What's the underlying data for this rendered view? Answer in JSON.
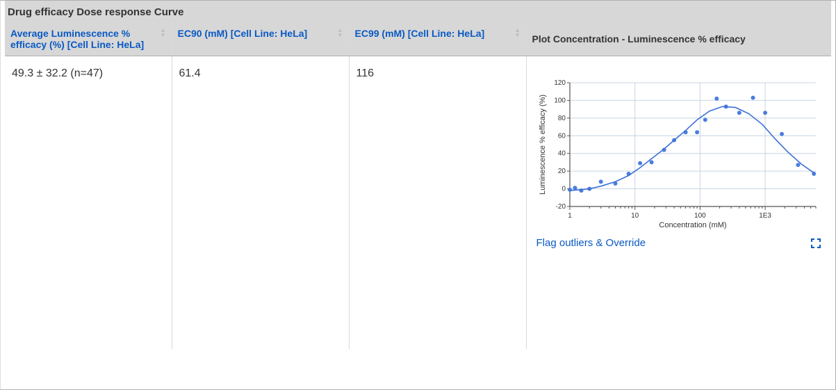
{
  "section_title": "Drug efficacy Dose response Curve",
  "columns": [
    {
      "label": "Average Luminescence % efficacy (%) [Cell Line: HeLa]",
      "sortable": true
    },
    {
      "label": "EC90 (mM) [Cell Line: HeLa]",
      "sortable": true
    },
    {
      "label": "EC99 (mM) [Cell Line: HeLa]",
      "sortable": true
    },
    {
      "label": "Plot Concentration - Luminescence % efficacy",
      "sortable": false
    }
  ],
  "row": {
    "avg_efficacy": "49.3 ± 32.2 (n=47)",
    "ec90": "61.4",
    "ec99": "116"
  },
  "actions": {
    "flag_override": "Flag outliers & Override"
  },
  "chart_data": {
    "type": "scatter",
    "title": "",
    "xlabel": "Concentration (mM)",
    "ylabel": "Luminescence % efficacy (%)",
    "x_scale": "log",
    "xlim": [
      1,
      6000
    ],
    "ylim": [
      -20,
      120
    ],
    "y_ticks": [
      -20,
      0,
      20,
      40,
      60,
      80,
      100,
      120
    ],
    "x_ticks": [
      1,
      10,
      100,
      1000
    ],
    "x_tick_labels": [
      "1",
      "10",
      "100",
      "1E3"
    ],
    "series": [
      {
        "name": "data",
        "kind": "points",
        "x": [
          1,
          1.2,
          1.5,
          2,
          3,
          5,
          8,
          12,
          18,
          28,
          40,
          60,
          90,
          120,
          180,
          250,
          400,
          650,
          1000,
          1800,
          3200,
          5600
        ],
        "y": [
          -1,
          1,
          -2,
          0,
          8,
          6,
          17,
          29,
          30,
          44,
          55,
          64,
          64,
          78,
          102,
          93,
          86,
          103,
          86,
          62,
          27,
          17
        ]
      },
      {
        "name": "fit",
        "kind": "line",
        "x": [
          1,
          1.5,
          2,
          3,
          5,
          8,
          12,
          18,
          28,
          40,
          60,
          90,
          140,
          220,
          350,
          560,
          900,
          1400,
          2200,
          3600,
          5600
        ],
        "y": [
          -2,
          -1,
          0,
          3,
          8,
          15,
          24,
          34,
          45,
          55,
          66,
          78,
          88,
          93,
          92,
          85,
          73,
          57,
          42,
          28,
          18
        ]
      }
    ]
  }
}
